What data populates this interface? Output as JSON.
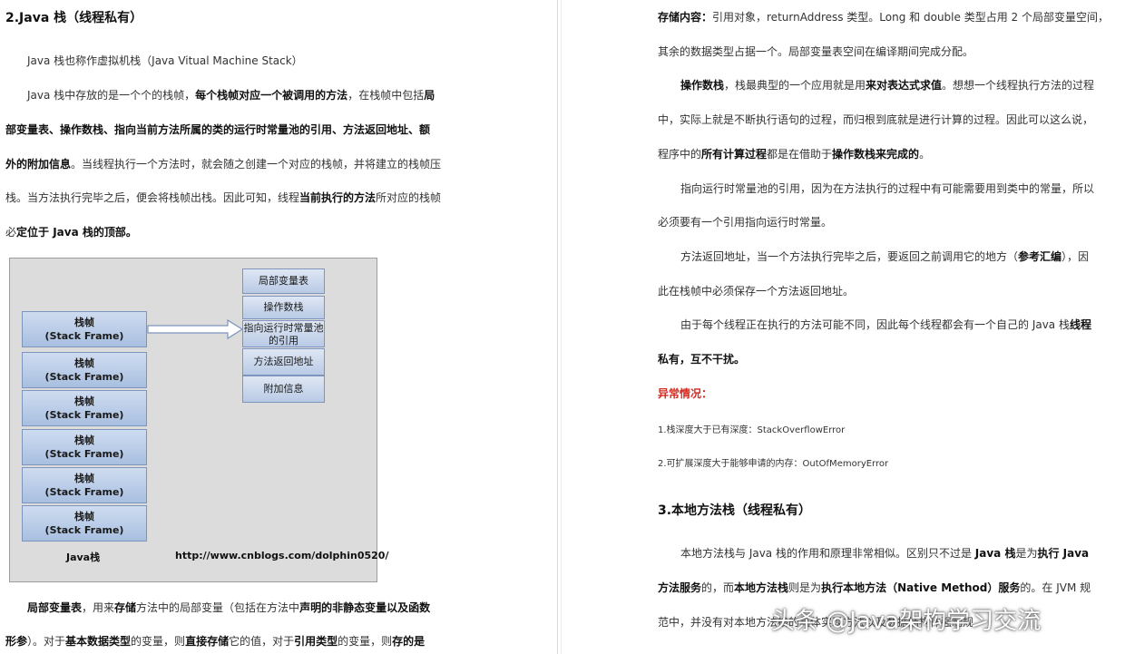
{
  "left": {
    "heading": "2.Java 栈（线程私有）",
    "para1": "Java 栈也称作虚拟机栈（Java Vitual Machine Stack）",
    "para2_l1_a": "Java 栈中存放的是一个个的栈帧，",
    "para2_l1_b": "每个栈帧对应一个被调用的方法",
    "para2_l1_c": "，在栈帧中包括",
    "para2_l1_d": "局",
    "para2_l2": "部变量表、操作数栈、指向当前方法所属的类的运行时常量池的引用、方法返回地址、额",
    "para2_l3_a": "外的附加信息",
    "para2_l3_b": "。当线程执行一个方法时，就会随之创建一个对应的栈帧，并将建立的栈帧压",
    "para2_l4_a": "栈。当方法执行完毕之后，便会将栈帧出栈。因此可知，线程",
    "para2_l4_b": "当前执行的方法",
    "para2_l4_c": "所对应的栈帧",
    "para2_l5_a": "必",
    "para2_l5_b": "定位于 Java 栈的顶部。",
    "diagram": {
      "frames": [
        {
          "l1": "栈帧",
          "l2": "(Stack  Frame)"
        },
        {
          "l1": "栈帧",
          "l2": "(Stack Frame)"
        },
        {
          "l1": "栈帧",
          "l2": "(Stack Frame)"
        },
        {
          "l1": "栈帧",
          "l2": "(Stack Frame)"
        },
        {
          "l1": "栈帧",
          "l2": "(Stack Frame)"
        },
        {
          "l1": "栈帧",
          "l2": "(Stack Frame)"
        }
      ],
      "parts": [
        "局部变量表",
        "操作数栈",
        "指向运行时常量池的引用",
        "方法返回地址",
        "附加信息"
      ],
      "caption": "Java栈",
      "url": "http://www.cnblogs.com/dolphin0520/"
    },
    "para3_l1_a": "局部变量表",
    "para3_l1_b": "，用来",
    "para3_l1_c": "存储",
    "para3_l1_d": "方法中的局部变量（包括在方法中",
    "para3_l1_e": "声明的非静态变量以及函数",
    "para3_l2_a": "形参",
    "para3_l2_b": "）。对于",
    "para3_l2_c": "基本数据类型",
    "para3_l2_d": "的变量，则",
    "para3_l2_e": "直接存储",
    "para3_l2_f": "它的值，对于",
    "para3_l2_g": "引用类型",
    "para3_l2_h": "的变量，则",
    "para3_l2_i": "存的是"
  },
  "right": {
    "r1_a": "存储内容：",
    "r1_b": "引用对象，returnAddress 类型。Long 和 double 类型占用 2 个局部变量空间，",
    "r2": "其余的数据类型占据一个。局部变量表空间在编译期间完成分配。",
    "r3_a": "操作数栈",
    "r3_b": "，栈最典型的一个应用就是用",
    "r3_c": "来对表达式求值",
    "r3_d": "。想想一个线程执行方法的过程",
    "r4": "中，实际上就是不断执行语句的过程，而归根到底就是进行计算的过程。因此可以这么说，",
    "r5_a": "程序中的",
    "r5_b": "所有计算过程",
    "r5_c": "都是在借助于",
    "r5_d": "操作数栈来完成的",
    "r5_e": "。",
    "r6": "指向运行时常量池的引用，因为在方法执行的过程中有可能需要用到类中的常量，所以",
    "r7": "必须要有一个引用指向运行时常量。",
    "r8_a": "方法返回地址，当一个方法执行完毕之后，要返回之前调用它的地方（",
    "r8_b": "参考汇编",
    "r8_c": "），因",
    "r9": "此在栈帧中必须保存一个方法返回地址。",
    "r10_a": "由于每个线程正在执行的方法可能不同，因此每个线程都会有一个自己的 Java 栈",
    "r10_b": "线程",
    "r11": "私有，互不干扰。",
    "exception_title": "异常情况：",
    "ex1": "1.栈深度大于已有深度：StackOverflowError",
    "ex2": "2.可扩展深度大于能够申请的内存：OutOfMemoryError",
    "heading3": "3.本地方法栈（线程私有）",
    "r12_a": "本地方法栈与 Java 栈的作用和原理非常相似。区别只不过是 ",
    "r12_b": "Java 栈",
    "r12_c": "是为",
    "r12_d": "执行 Java",
    "r13_a": "方法服务",
    "r13_b": "的，而",
    "r13_c": "本地方法栈",
    "r13_d": "则是为",
    "r13_e": "执行本地方法（Native Method）服务",
    "r13_f": "的。在 JVM 规",
    "r14": "范中，并没有对本地方法栈的具体实现方法以及数据结构作强制规"
  },
  "watermark": "头条 @Java架构学习交流"
}
